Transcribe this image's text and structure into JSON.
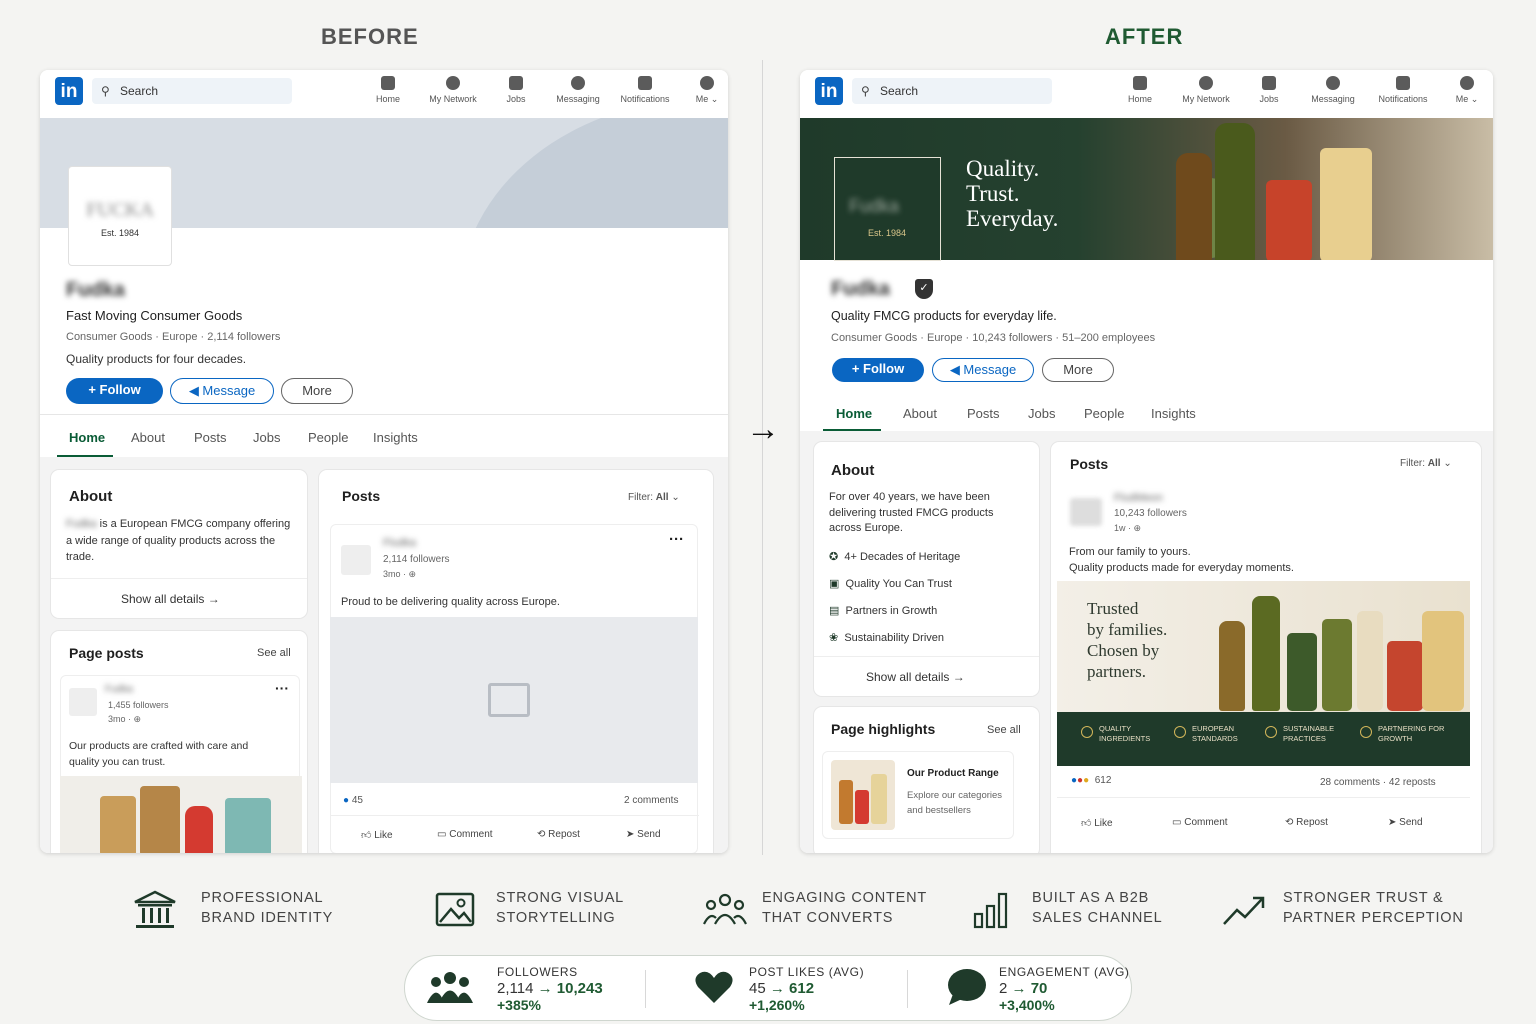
{
  "headers": {
    "before": "BEFORE",
    "after": "AFTER"
  },
  "nav": {
    "logo": "in",
    "search_placeholder": "Search",
    "items": [
      "Home",
      "My Network",
      "Jobs",
      "Messaging",
      "Notifications",
      "Me"
    ]
  },
  "before": {
    "banner_logo_text": "FUCKA",
    "est": "Est. 1984",
    "company_name": "Fudka",
    "tagline": "Fast Moving Consumer Goods",
    "meta": "Consumer Goods · Europe · 2,114 followers",
    "description": "Quality products for four decades.",
    "follow": "+ Follow",
    "message": "Message",
    "more": "More",
    "tabs": [
      "Home",
      "About",
      "Posts",
      "Jobs",
      "People",
      "Insights"
    ],
    "about": {
      "title": "About",
      "text": "is a European FMCG company offering a wide range of quality products across the trade.",
      "show_all": "Show all details →"
    },
    "page_posts": {
      "title": "Page posts",
      "see_all": "See all",
      "followers": "1,455 followers",
      "time": "3mo ·",
      "text": "Our products are crafted with care and quality you can trust."
    },
    "posts": {
      "title": "Posts",
      "filter_label": "Filter:",
      "filter_value": "All",
      "author": "Fludka",
      "followers": "2,114 followers",
      "time": "3mo ·",
      "text": "Proud to be delivering quality across Europe.",
      "likes": "45",
      "comments": "2 comments",
      "actions": [
        "Like",
        "Comment",
        "Repost",
        "Send"
      ]
    }
  },
  "after": {
    "est": "Est. 1984",
    "banner_slogan": [
      "Quality.",
      "Trust.",
      "Everyday."
    ],
    "company_name": "Fudka",
    "tagline": "Quality FMCG products for everyday life.",
    "meta": "Consumer Goods · Europe · 10,243 followers · 51–200 employees",
    "follow": "+ Follow",
    "message": "Message",
    "more": "More",
    "tabs": [
      "Home",
      "About",
      "Posts",
      "Jobs",
      "People",
      "Insights"
    ],
    "about": {
      "title": "About",
      "text": "For over 40 years, we have been delivering trusted FMCG products across Europe.",
      "items": [
        "4+ Decades of Heritage",
        "Quality You Can Trust",
        "Partners in Growth",
        "Sustainability Driven"
      ],
      "show_all": "Show all details →"
    },
    "highlights": {
      "title": "Page highlights",
      "see_all": "See all",
      "item_title": "Our Product Range",
      "item_text": "Explore our categories and bestsellers"
    },
    "posts": {
      "title": "Posts",
      "filter_label": "Filter:",
      "filter_value": "All",
      "author": "FludMeon",
      "followers": "10,243 followers",
      "time": "1w ·",
      "text1": "From our family to yours.",
      "text2": "Quality products made for everyday moments.",
      "image_text": [
        "Trusted",
        "by families.",
        "Chosen by",
        "partners."
      ],
      "badges": [
        "QUALITY INGREDIENTS",
        "EUROPEAN STANDARDS",
        "SUSTAINABLE PRACTICES",
        "PARTNERING FOR GROWTH"
      ],
      "reactions": "612",
      "comments": "28 comments · 42 reposts",
      "actions": [
        "Like",
        "Comment",
        "Repost",
        "Send"
      ]
    }
  },
  "benefits": [
    {
      "line1": "PROFESSIONAL",
      "line2": "BRAND IDENTITY",
      "icon": "bank-icon"
    },
    {
      "line1": "STRONG VISUAL",
      "line2": "STORYTELLING",
      "icon": "image-icon"
    },
    {
      "line1": "ENGAGING CONTENT",
      "line2": "THAT CONVERTS",
      "icon": "people-icon"
    },
    {
      "line1": "BUILT AS A B2B",
      "line2": "SALES CHANNEL",
      "icon": "bar-chart-icon"
    },
    {
      "line1": "STRONGER TRUST &",
      "line2": "PARTNER PERCEPTION",
      "icon": "trend-up-icon"
    }
  ],
  "metrics": [
    {
      "label": "FOLLOWERS",
      "from": "2,114",
      "to": "10,243",
      "change": "+385%"
    },
    {
      "label": "POST LIKES (AVG)",
      "from": "45",
      "to": "612",
      "change": "+1,260%"
    },
    {
      "label": "ENGAGEMENT (AVG)",
      "from": "2",
      "to": "70",
      "change": "+3,400%"
    }
  ],
  "colors": {
    "linkedin_blue": "#0a66c2",
    "brand_green": "#1f3a2a",
    "accent_green": "#1f5a32"
  }
}
